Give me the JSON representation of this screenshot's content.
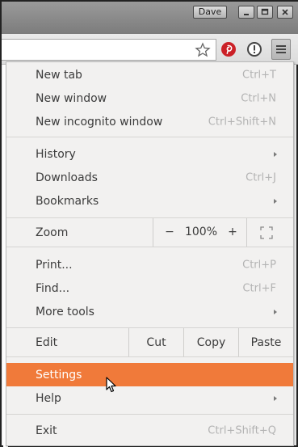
{
  "titlebar": {
    "user": "Dave"
  },
  "icons": {
    "star": "star-icon",
    "pinterest": "pinterest-icon",
    "extension": "exclamation-circle-icon",
    "menu": "hamburger-menu-icon",
    "minimize": "minimize-icon",
    "maximize": "maximize-icon",
    "close": "close-icon",
    "fullscreen": "fullscreen-icon",
    "cursor": "mouse-pointer-icon"
  },
  "colors": {
    "highlight": "#f07a3a",
    "pinterest": "#cb2027"
  },
  "menu": {
    "new_tab": {
      "label": "New tab",
      "accel": "Ctrl+T"
    },
    "new_window": {
      "label": "New window",
      "accel": "Ctrl+N"
    },
    "new_incognito": {
      "label": "New incognito window",
      "accel": "Ctrl+Shift+N"
    },
    "history": {
      "label": "History"
    },
    "downloads": {
      "label": "Downloads",
      "accel": "Ctrl+J"
    },
    "bookmarks": {
      "label": "Bookmarks"
    },
    "zoom": {
      "label": "Zoom",
      "minus": "−",
      "level": "100%",
      "plus": "+"
    },
    "print": {
      "label": "Print...",
      "accel": "Ctrl+P"
    },
    "find": {
      "label": "Find...",
      "accel": "Ctrl+F"
    },
    "more_tools": {
      "label": "More tools"
    },
    "edit": {
      "label": "Edit",
      "cut": "Cut",
      "copy": "Copy",
      "paste": "Paste"
    },
    "settings": {
      "label": "Settings"
    },
    "help": {
      "label": "Help"
    },
    "exit": {
      "label": "Exit",
      "accel": "Ctrl+Shift+Q"
    }
  }
}
